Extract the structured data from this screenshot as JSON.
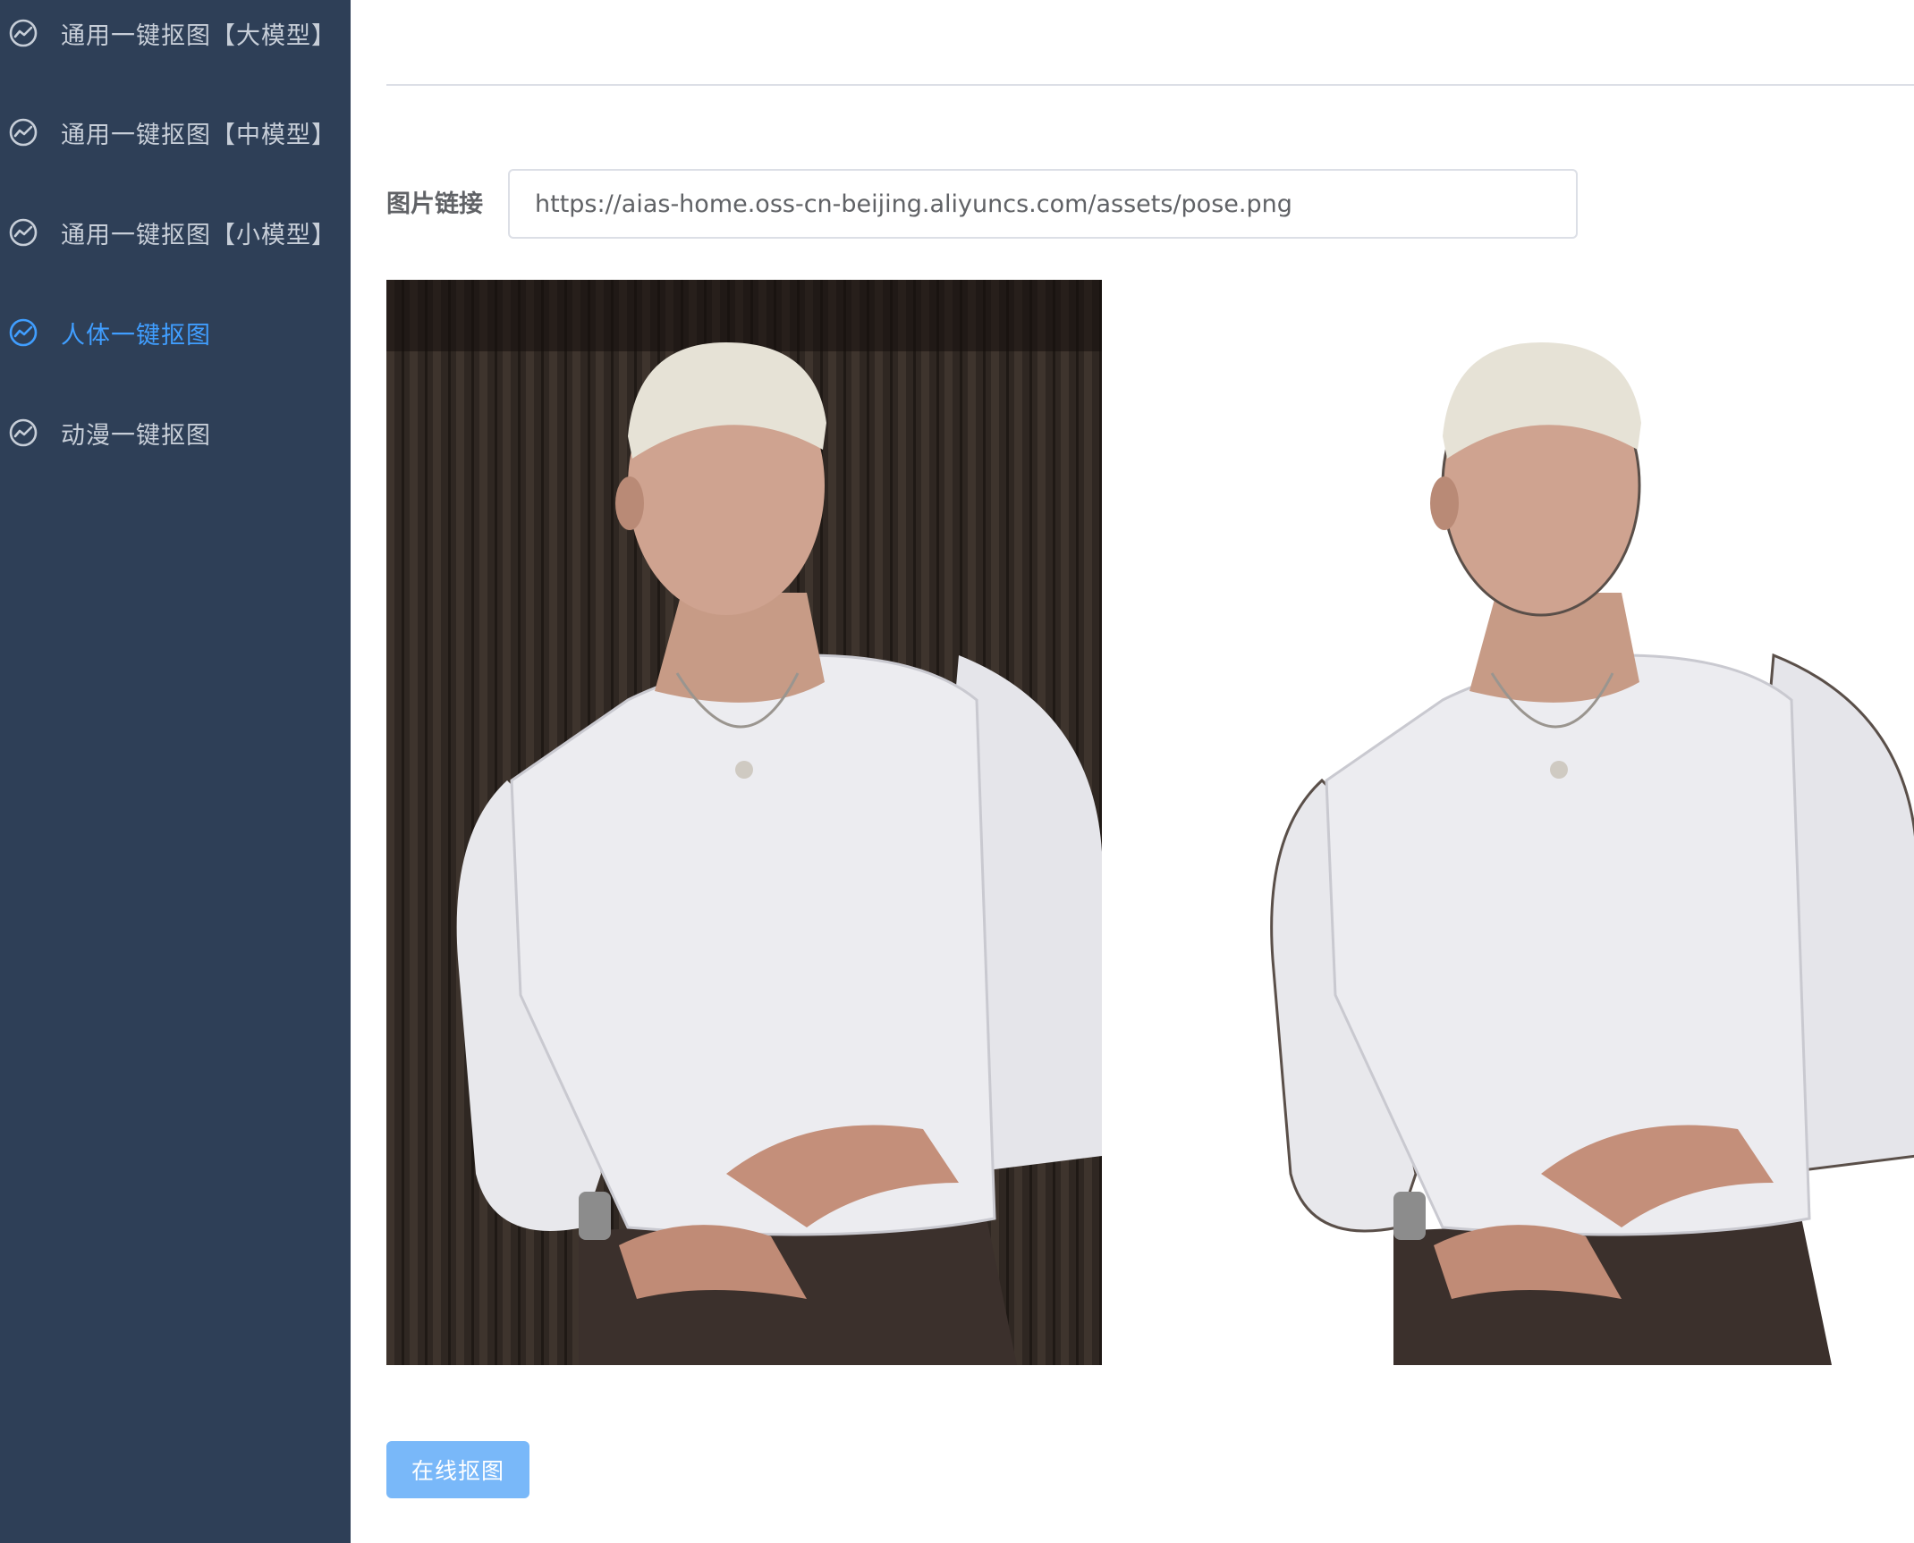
{
  "sidebar": {
    "items": [
      {
        "label": "通用一键抠图【大模型】",
        "icon": "chart-circle-icon",
        "active": false
      },
      {
        "label": "通用一键抠图【中模型】",
        "icon": "chart-circle-icon",
        "active": false
      },
      {
        "label": "通用一键抠图【小模型】",
        "icon": "chart-circle-icon",
        "active": false
      },
      {
        "label": "人体一键抠图",
        "icon": "chart-circle-icon",
        "active": true
      },
      {
        "label": "动漫一键抠图",
        "icon": "chart-circle-icon",
        "active": false
      }
    ]
  },
  "main": {
    "url_label": "图片链接",
    "url_value": "https://aias-home.oss-cn-beijing.aliyuncs.com/assets/pose.png",
    "submit_label": "在线抠图"
  },
  "colors": {
    "sidebar_bg": "#2e3f57",
    "sidebar_text": "#c7ced8",
    "active": "#409eff",
    "button_bg": "#79b8f9"
  }
}
